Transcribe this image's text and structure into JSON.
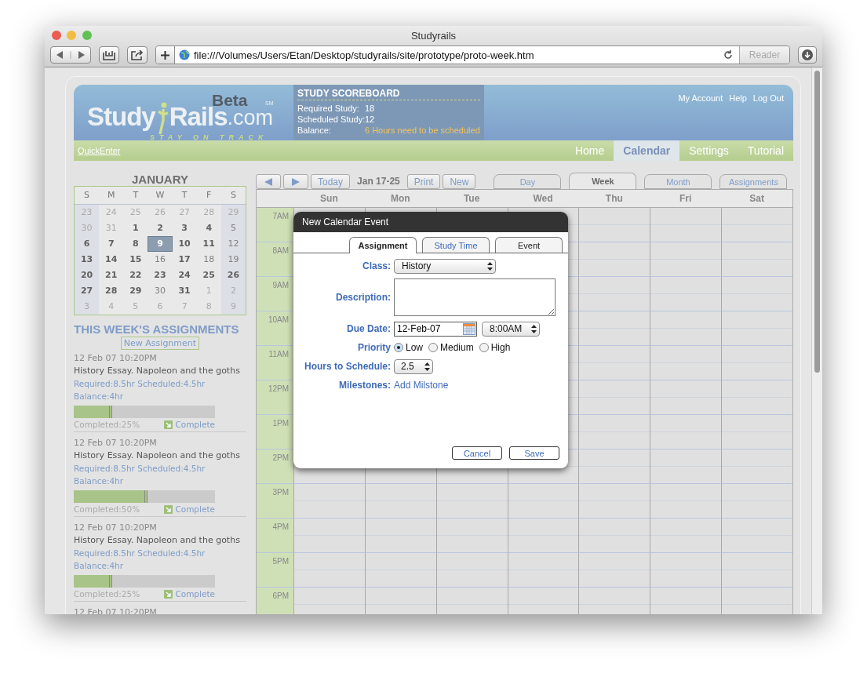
{
  "browser": {
    "title": "Studyrails",
    "url": "file:///Volumes/Users/Etan/Desktop/studyrails/site/prototype/proto-week.htm",
    "reader": "Reader"
  },
  "header": {
    "logo": {
      "study": "Study",
      "rails": "Rails",
      "domain": ".com",
      "badge": "Beta",
      "mark": "SM",
      "tagline": "STAY ON TRACK"
    },
    "scoreboard": {
      "title": "STUDY SCOREBOARD",
      "rows": [
        {
          "label": "Required Study:",
          "value": "18",
          "kind": "normal"
        },
        {
          "label": "Scheduled Study:",
          "value": "12",
          "kind": "normal"
        },
        {
          "label": "Balance:",
          "value": "6 Hours need to be scheduled",
          "kind": "warning"
        }
      ]
    },
    "account_links": [
      "My Account",
      "Help",
      "Log Out"
    ]
  },
  "nav": {
    "quick_enter": "QuickEnter",
    "items": [
      {
        "label": "Home",
        "selected": false
      },
      {
        "label": "Calendar",
        "selected": true
      },
      {
        "label": "Settings",
        "selected": false
      },
      {
        "label": "Tutorial",
        "selected": false
      }
    ]
  },
  "mini_calendar": {
    "month": "JANUARY",
    "weekdays": [
      "S",
      "M",
      "T",
      "W",
      "T",
      "F",
      "S"
    ],
    "weeks": [
      [
        {
          "label": "23",
          "kind": "other",
          "selected": false
        },
        {
          "label": "24",
          "kind": "other",
          "selected": false
        },
        {
          "label": "25",
          "kind": "other",
          "selected": false
        },
        {
          "label": "26",
          "kind": "other",
          "selected": false
        },
        {
          "label": "27",
          "kind": "other",
          "selected": false
        },
        {
          "label": "28",
          "kind": "other",
          "selected": false
        },
        {
          "label": "29",
          "kind": "other",
          "selected": false
        }
      ],
      [
        {
          "label": "30",
          "kind": "other",
          "selected": false
        },
        {
          "label": "31",
          "kind": "other",
          "selected": false
        },
        {
          "label": "1",
          "kind": "busy",
          "selected": false
        },
        {
          "label": "2",
          "kind": "busy",
          "selected": false
        },
        {
          "label": "3",
          "kind": "busy",
          "selected": false
        },
        {
          "label": "4",
          "kind": "busy",
          "selected": false
        },
        {
          "label": "5",
          "kind": "free",
          "selected": false
        }
      ],
      [
        {
          "label": "6",
          "kind": "busy",
          "selected": false
        },
        {
          "label": "7",
          "kind": "busy",
          "selected": false
        },
        {
          "label": "8",
          "kind": "busy",
          "selected": false
        },
        {
          "label": "9",
          "kind": "busy",
          "selected": true
        },
        {
          "label": "10",
          "kind": "busy",
          "selected": false
        },
        {
          "label": "11",
          "kind": "busy",
          "selected": false
        },
        {
          "label": "12",
          "kind": "free",
          "selected": false
        }
      ],
      [
        {
          "label": "13",
          "kind": "busy",
          "selected": false
        },
        {
          "label": "14",
          "kind": "busy",
          "selected": false
        },
        {
          "label": "15",
          "kind": "busy",
          "selected": false
        },
        {
          "label": "16",
          "kind": "free",
          "selected": false
        },
        {
          "label": "17",
          "kind": "busy",
          "selected": false
        },
        {
          "label": "18",
          "kind": "free",
          "selected": false
        },
        {
          "label": "19",
          "kind": "free",
          "selected": false
        }
      ],
      [
        {
          "label": "20",
          "kind": "busy",
          "selected": false
        },
        {
          "label": "21",
          "kind": "busy",
          "selected": false
        },
        {
          "label": "22",
          "kind": "busy",
          "selected": false
        },
        {
          "label": "23",
          "kind": "busy",
          "selected": false
        },
        {
          "label": "24",
          "kind": "busy",
          "selected": false
        },
        {
          "label": "25",
          "kind": "busy",
          "selected": false
        },
        {
          "label": "26",
          "kind": "busy",
          "selected": false
        }
      ],
      [
        {
          "label": "27",
          "kind": "busy",
          "selected": false
        },
        {
          "label": "28",
          "kind": "busy",
          "selected": false
        },
        {
          "label": "29",
          "kind": "busy",
          "selected": false
        },
        {
          "label": "30",
          "kind": "free",
          "selected": false
        },
        {
          "label": "31",
          "kind": "busy",
          "selected": false
        },
        {
          "label": "1",
          "kind": "other",
          "selected": false
        },
        {
          "label": "2",
          "kind": "other",
          "selected": false
        }
      ],
      [
        {
          "label": "3",
          "kind": "other",
          "selected": false
        },
        {
          "label": "4",
          "kind": "other",
          "selected": false
        },
        {
          "label": "5",
          "kind": "other",
          "selected": false
        },
        {
          "label": "6",
          "kind": "other",
          "selected": false
        },
        {
          "label": "7",
          "kind": "other",
          "selected": false
        },
        {
          "label": "8",
          "kind": "other",
          "selected": false
        },
        {
          "label": "9",
          "kind": "other",
          "selected": false
        }
      ]
    ]
  },
  "assignments": {
    "title": "THIS WEEK'S ASSIGNMENTS",
    "new_button": "New Assignment",
    "items": [
      {
        "date": "12 Feb 07 10:20PM",
        "title": "History Essay. Napoleon and the goths",
        "hours": "Required:8.5hr Scheduled:4.5hr",
        "balance": "Balance:4hr",
        "level": 0.25,
        "completed": "Completed:25%",
        "complete_link": "Complete"
      },
      {
        "date": "12 Feb 07 10:20PM",
        "title": "History Essay. Napoleon and the goths",
        "hours": "Required:8.5hr Scheduled:4.5hr",
        "balance": "Balance:4hr",
        "level": 0.5,
        "completed": "Completed:50%",
        "complete_link": "Complete"
      },
      {
        "date": "12 Feb 07 10:20PM",
        "title": "History Essay. Napoleon and the goths",
        "hours": "Required:8.5hr Scheduled:4.5hr",
        "balance": "Balance:4hr",
        "level": 0.25,
        "completed": "Completed:25%",
        "complete_link": "Complete"
      },
      {
        "date": "12 Feb 07 10:20PM"
      }
    ]
  },
  "week_view": {
    "today": "Today",
    "range": "Jan 17-25",
    "print": "Print",
    "new": "New",
    "views": [
      {
        "label": "Day",
        "selected": false
      },
      {
        "label": "Week",
        "selected": true
      },
      {
        "label": "Month",
        "selected": false
      },
      {
        "label": "Assignments",
        "selected": false
      }
    ],
    "days": [
      "Sun",
      "Mon",
      "Tue",
      "Wed",
      "Thu",
      "Fri",
      "Sat"
    ],
    "hours": [
      "7AM",
      "8AM",
      "9AM",
      "10AM",
      "11AM",
      "12PM",
      "1PM",
      "2PM",
      "3PM",
      "4PM",
      "5PM",
      "6PM"
    ]
  },
  "dialog": {
    "title": "New Calendar Event",
    "tabs": [
      {
        "label": "Assignment",
        "selected": true
      },
      {
        "label": "Study Time",
        "selected": false
      },
      {
        "label": "Event",
        "selected": false
      }
    ],
    "class_label": "Class:",
    "class_value": "History",
    "description_label": "Description:",
    "due_label": "Due Date:",
    "due_date": "12-Feb-07",
    "due_time": "8:00AM",
    "priority_label": "Priority",
    "priorities": [
      {
        "label": "Low",
        "selected": true
      },
      {
        "label": "Medium",
        "selected": false
      },
      {
        "label": "High",
        "selected": false
      }
    ],
    "hours_label": "Hours to Schedule:",
    "hours_value": "2.5",
    "milestones_label": "Milestones:",
    "add_milestone": "Add Milstone",
    "buttons": [
      "Cancel",
      "Save"
    ]
  }
}
